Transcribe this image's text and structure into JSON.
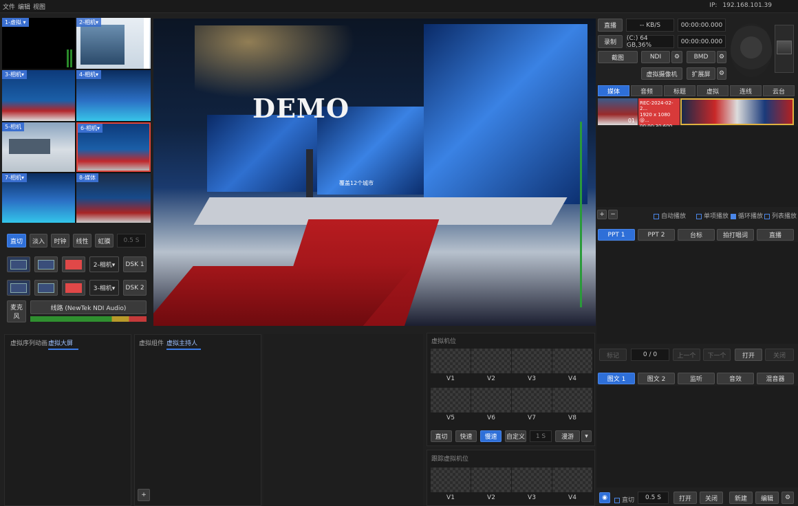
{
  "menu": {
    "file": "文件",
    "edit": "编辑",
    "view": "视图"
  },
  "ip": {
    "label": "IP:",
    "value": "192.168.101.39"
  },
  "multiview": [
    {
      "label": "1-虚拟 ▾"
    },
    {
      "label": "2-相机▾"
    },
    {
      "label": "3-相机▾"
    },
    {
      "label": "4-相机▾"
    },
    {
      "label": "5-相机"
    },
    {
      "label": "6-相机▾"
    },
    {
      "label": "7-相机▾"
    },
    {
      "label": "8-媒体"
    }
  ],
  "preview": {
    "title": "DEMO",
    "screen_text": "覆盖12个城市"
  },
  "transitions": {
    "cut": "直切",
    "fade_in": "淡入",
    "clock": "时钟",
    "line": "线性",
    "aperture": "虹膜",
    "duration": "0.5 S"
  },
  "dsk1": {
    "source": "2-相机▾",
    "label": "DSK 1"
  },
  "dsk2": {
    "source": "3-相机▾",
    "label": "DSK 2"
  },
  "audio": {
    "mic": "麦克风",
    "line": "线路 (NewTek NDI Audio)"
  },
  "top_controls": {
    "live": "直播",
    "kbs": "-- KB/S",
    "live_time": "00:00:00.000",
    "record": "录制",
    "disk": "(C:) 64 GB,36%",
    "record_time": "00:00:00.000",
    "screenshot": "截图",
    "ndi": "NDI",
    "bmd": "BMD",
    "virtual_camera": "虚拟摄像机",
    "extend": "扩展屏"
  },
  "media_tabs": [
    "媒体",
    "音频",
    "标题",
    "虚拟",
    "连线",
    "云台"
  ],
  "media_items": [
    {
      "index": "01"
    },
    {
      "name": "REC-2024-02-2...",
      "res": "1920 x 1080 @...",
      "time": "00:00:30:600"
    }
  ],
  "playback_opts": {
    "auto": "自动播放",
    "single": "单项播放",
    "loop": "循环播放",
    "list": "列表播放"
  },
  "ppt_tabs": [
    "PPT 1",
    "PPT 2",
    "台标",
    "拍打唱词",
    "直播"
  ],
  "ppt_controls": {
    "mark": "标记",
    "count": "0 / 0",
    "prev": "上一个",
    "next": "下一个",
    "open": "打开",
    "close": "关闭"
  },
  "graphic_tabs": [
    "图文 1",
    "图文 2",
    "监听",
    "音效",
    "混音器"
  ],
  "graphic_controls": {
    "cut": "直切",
    "duration": "0.5 S",
    "open": "打开",
    "close": "关闭",
    "new": "新建",
    "edit": "编辑"
  },
  "bottom_left": {
    "tab1": "虚拟序列动画",
    "tab2": "虚拟大屏"
  },
  "bottom_mid": {
    "tab1": "虚拟组件",
    "tab2": "虚拟主持人"
  },
  "virtual_positions": {
    "title": "虚拟机位",
    "slots": [
      "V1",
      "V2",
      "V3",
      "V4",
      "V5",
      "V6",
      "V7",
      "V8"
    ],
    "cut": "直切",
    "fast": "快速",
    "slow": "慢速",
    "custom": "自定义",
    "duration": "1 S",
    "roam": "漫游"
  },
  "tracking_positions": {
    "title": "跟踪虚拟机位",
    "slots": [
      "V1",
      "V2",
      "V3",
      "V4"
    ]
  }
}
